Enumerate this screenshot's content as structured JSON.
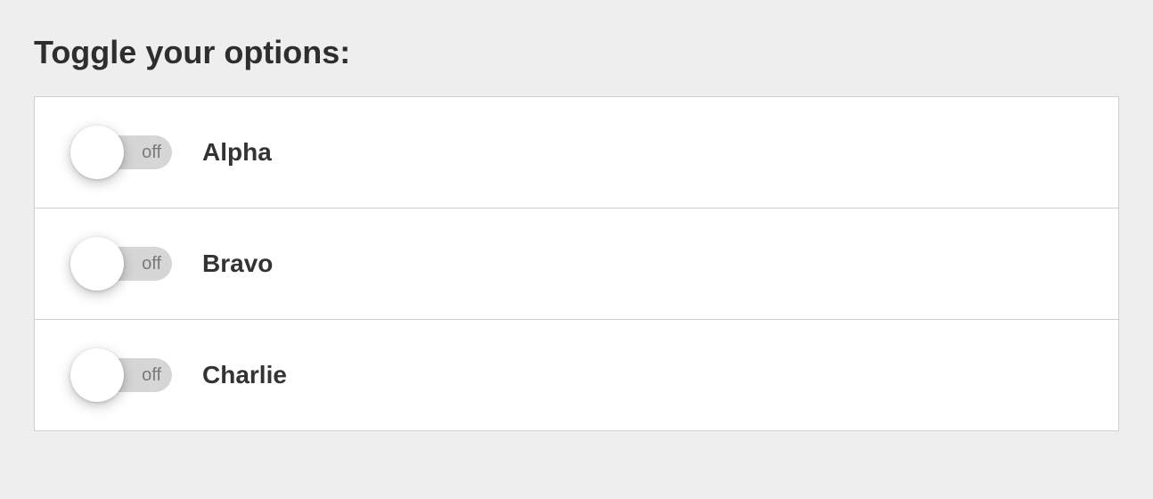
{
  "heading": "Toggle your options:",
  "toggle_off_label": "off",
  "options": [
    {
      "label": "Alpha",
      "state": "off"
    },
    {
      "label": "Bravo",
      "state": "off"
    },
    {
      "label": "Charlie",
      "state": "off"
    }
  ]
}
